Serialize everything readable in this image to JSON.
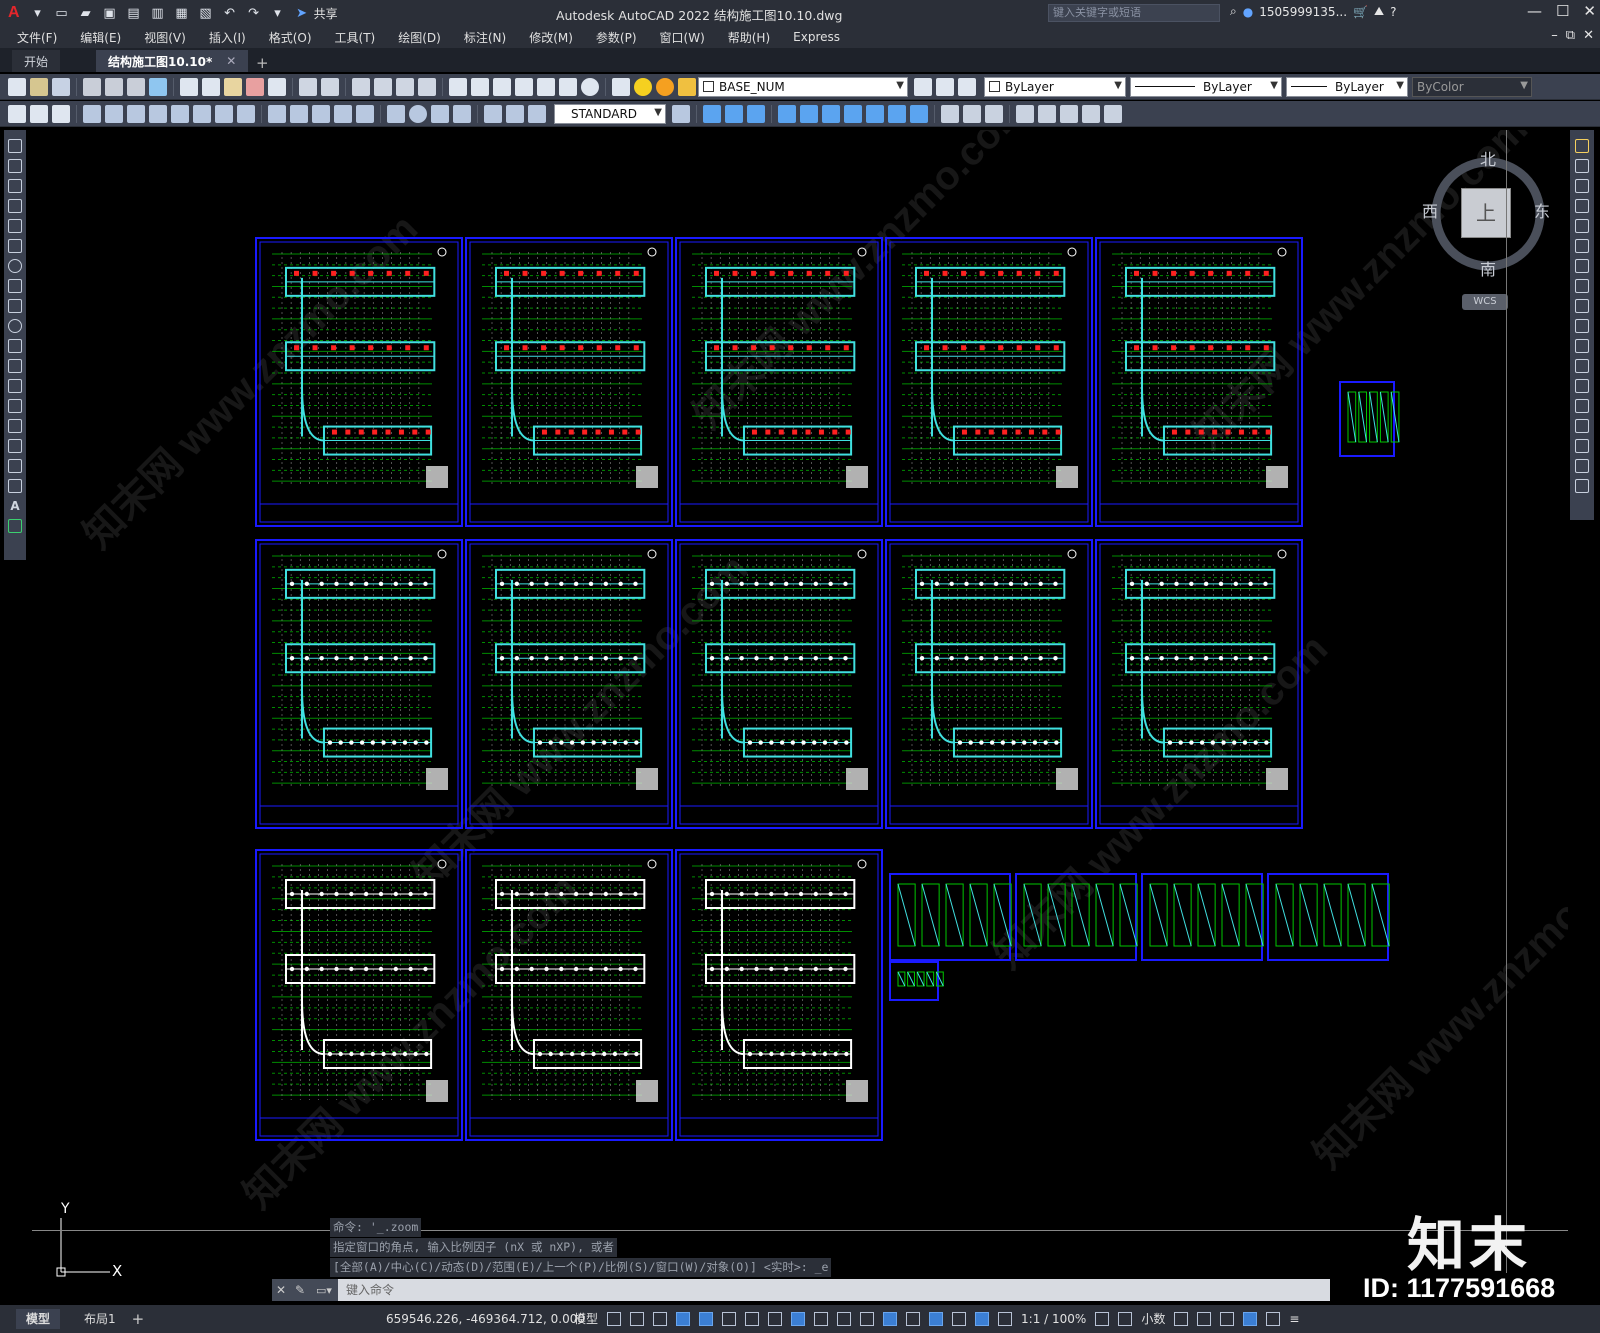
{
  "app": {
    "logo": "A",
    "title": "Autodesk AutoCAD 2022    结构施工图10.10.dwg",
    "share_label": "共享",
    "search_placeholder": "键入关键字或短语",
    "user": "1505999135...",
    "menu": [
      "文件(F)",
      "编辑(E)",
      "视图(V)",
      "插入(I)",
      "格式(O)",
      "工具(T)",
      "绘图(D)",
      "标注(N)",
      "修改(M)",
      "参数(P)",
      "窗口(W)",
      "帮助(H)",
      "Express"
    ]
  },
  "tabs": [
    {
      "label": "开始"
    },
    {
      "label": "结构施工图10.10*"
    }
  ],
  "properties": {
    "layer": "BASE_NUM",
    "color": "ByLayer",
    "linetype": "ByLayer",
    "lineweight": "ByLayer",
    "plotstyle": "ByColor",
    "textstyle": "STANDARD"
  },
  "viewcube": {
    "north": "北",
    "south": "南",
    "west": "西",
    "east": "东",
    "top": "上",
    "wcs": "WCS"
  },
  "ucs": {
    "y_label": "Y",
    "x_label": "X"
  },
  "command": {
    "history": [
      "命令: '_.zoom",
      "指定窗口的角点, 输入比例因子 (nX 或 nXP), 或者",
      "[全部(A)/中心(C)/动态(D)/范围(E)/上一个(P)/比例(S)/窗口(W)/对象(O)] <实时>: _e"
    ],
    "placeholder": "键入命令"
  },
  "status": {
    "layouts": [
      "模型",
      "布局1"
    ],
    "coords": "659546.226, -469364.712, 0.000",
    "model_label": "模型",
    "scale": "1:1 / 100%",
    "units": "小数"
  },
  "watermark": {
    "logo": "知末",
    "id": "ID: 1177591668",
    "diagonal": "知末网 www.znzmo.com"
  },
  "colors": {
    "frame": "#1a1aff",
    "grid": "#00c800",
    "beam": "#40e0e0",
    "rebar": "#ff2020"
  }
}
